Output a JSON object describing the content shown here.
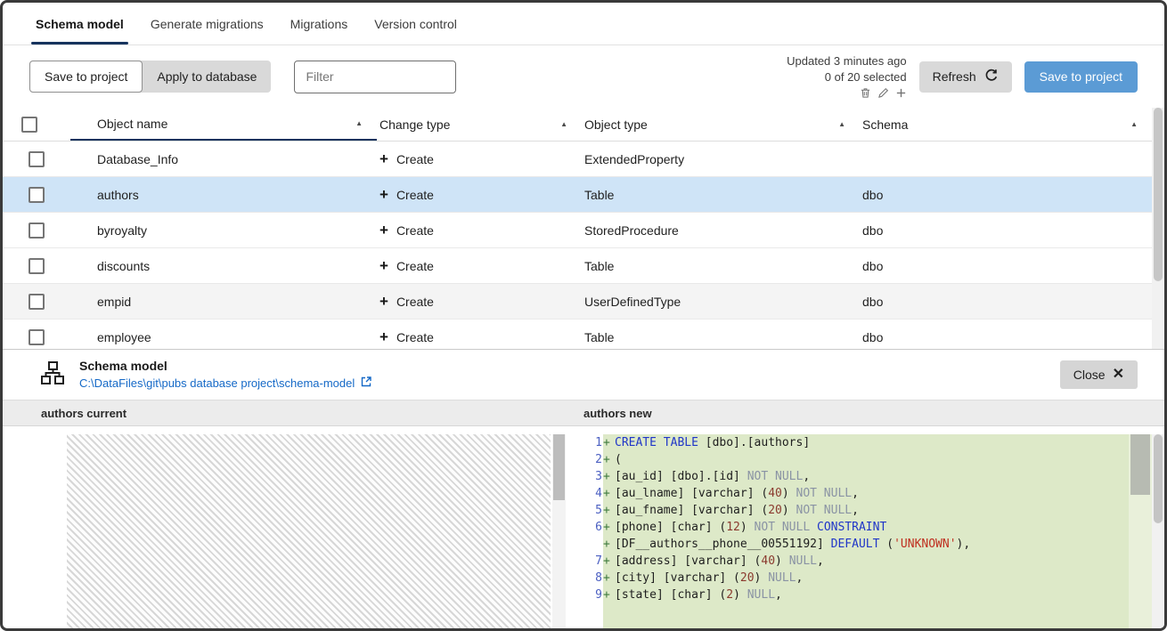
{
  "tabs": [
    {
      "label": "Schema model",
      "active": true
    },
    {
      "label": "Generate migrations",
      "active": false
    },
    {
      "label": "Migrations",
      "active": false
    },
    {
      "label": "Version control",
      "active": false
    }
  ],
  "toolbar": {
    "save_to_project_label": "Save to project",
    "apply_to_database_label": "Apply to database",
    "filter_placeholder": "Filter",
    "updated_text": "Updated 3 minutes ago",
    "selected_text": "0 of 20 selected",
    "refresh_label": "Refresh",
    "primary_save_label": "Save to project"
  },
  "table": {
    "columns": [
      "Object name",
      "Change type",
      "Object type",
      "Schema"
    ],
    "rows": [
      {
        "name": "Database_Info",
        "change": "Create",
        "type": "ExtendedProperty",
        "schema": "",
        "selected": false,
        "shaded": false
      },
      {
        "name": "authors",
        "change": "Create",
        "type": "Table",
        "schema": "dbo",
        "selected": true,
        "shaded": false
      },
      {
        "name": "byroyalty",
        "change": "Create",
        "type": "StoredProcedure",
        "schema": "dbo",
        "selected": false,
        "shaded": false
      },
      {
        "name": "discounts",
        "change": "Create",
        "type": "Table",
        "schema": "dbo",
        "selected": false,
        "shaded": false
      },
      {
        "name": "empid",
        "change": "Create",
        "type": "UserDefinedType",
        "schema": "dbo",
        "selected": false,
        "shaded": true
      },
      {
        "name": "employee",
        "change": "Create",
        "type": "Table",
        "schema": "dbo",
        "selected": false,
        "shaded": false
      }
    ]
  },
  "panel": {
    "title": "Schema model",
    "path": "C:\\DataFiles\\git\\pubs database project\\schema-model",
    "close_label": "Close"
  },
  "diff": {
    "left_header": "authors current",
    "right_header": "authors new",
    "lines": [
      {
        "num": "1",
        "sign": "+",
        "tokens": [
          [
            "kw",
            "CREATE TABLE"
          ],
          [
            "pl",
            " [dbo].[authors]"
          ]
        ]
      },
      {
        "num": "2",
        "sign": "+",
        "tokens": [
          [
            "pl",
            "("
          ]
        ]
      },
      {
        "num": "3",
        "sign": "+",
        "tokens": [
          [
            "pl",
            "[au_id] [dbo].[id] "
          ],
          [
            "kw2",
            "NOT NULL"
          ],
          [
            "pl",
            ","
          ]
        ]
      },
      {
        "num": "4",
        "sign": "+",
        "tokens": [
          [
            "pl",
            "[au_lname] [varchar] ("
          ],
          [
            "num",
            "40"
          ],
          [
            "pl",
            ") "
          ],
          [
            "kw2",
            "NOT NULL"
          ],
          [
            "pl",
            ","
          ]
        ]
      },
      {
        "num": "5",
        "sign": "+",
        "tokens": [
          [
            "pl",
            "[au_fname] [varchar] ("
          ],
          [
            "num",
            "20"
          ],
          [
            "pl",
            ") "
          ],
          [
            "kw2",
            "NOT NULL"
          ],
          [
            "pl",
            ","
          ]
        ]
      },
      {
        "num": "6",
        "sign": "+",
        "tokens": [
          [
            "pl",
            "[phone] [char] ("
          ],
          [
            "num",
            "12"
          ],
          [
            "pl",
            ") "
          ],
          [
            "kw2",
            "NOT NULL"
          ],
          [
            "pl",
            " "
          ],
          [
            "kw",
            "CONSTRAINT"
          ]
        ]
      },
      {
        "num": "",
        "sign": "+",
        "tokens": [
          [
            "pl",
            "[DF__authors__phone__00551192] "
          ],
          [
            "kw",
            "DEFAULT"
          ],
          [
            "pl",
            " ("
          ],
          [
            "str",
            "'UNKNOWN'"
          ],
          [
            "pl",
            "),"
          ]
        ]
      },
      {
        "num": "7",
        "sign": "+",
        "tokens": [
          [
            "pl",
            "[address] [varchar] ("
          ],
          [
            "num",
            "40"
          ],
          [
            "pl",
            ") "
          ],
          [
            "kw2",
            "NULL"
          ],
          [
            "pl",
            ","
          ]
        ]
      },
      {
        "num": "8",
        "sign": "+",
        "tokens": [
          [
            "pl",
            "[city] [varchar] ("
          ],
          [
            "num",
            "20"
          ],
          [
            "pl",
            ") "
          ],
          [
            "kw2",
            "NULL"
          ],
          [
            "pl",
            ","
          ]
        ]
      },
      {
        "num": "9",
        "sign": "+",
        "tokens": [
          [
            "pl",
            "[state] [char] ("
          ],
          [
            "num",
            "2"
          ],
          [
            "pl",
            ") "
          ],
          [
            "kw2",
            "NULL"
          ],
          [
            "pl",
            ","
          ]
        ]
      }
    ]
  },
  "colors": {
    "primary_button": "#5b9bd5",
    "active_tab_underline": "#16335e",
    "selected_row": "#cfe4f7",
    "diff_added_bg": "#dde9c8",
    "keyword": "#2036c8",
    "string": "#bf2e1f",
    "link": "#1569c7"
  }
}
